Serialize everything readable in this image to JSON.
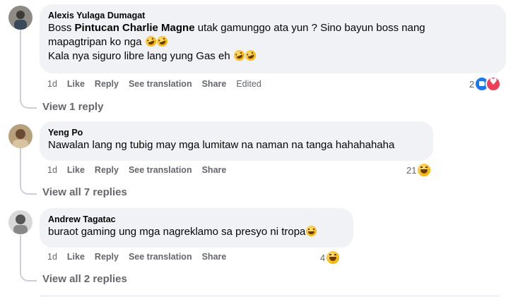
{
  "comments": [
    {
      "author": "Alexis Yulaga Dumagat",
      "line1_pre": "Boss ",
      "mention": "Pintucan Charlie Magne",
      "line1_post": " utak gamunggo ata yun ? Sino bayun boss nang",
      "line2": "mapagtripan ko nga",
      "line3": "Kala nya siguro libre lang yung Gas eh",
      "actions": {
        "time": "1d",
        "like": "Like",
        "reply": "Reply",
        "translate": "See translation",
        "share": "Share",
        "edited": "Edited"
      },
      "reaction_count": "2",
      "view_replies": "View 1 reply"
    },
    {
      "author": "Yeng Po",
      "line1": "Nawalan lang ng tubig may mga lumitaw na naman na tanga hahahahaha",
      "actions": {
        "time": "1d",
        "like": "Like",
        "reply": "Reply",
        "translate": "See translation",
        "share": "Share"
      },
      "reaction_count": "21",
      "view_replies": "View all 7 replies"
    },
    {
      "author": "Andrew Tagatac",
      "line1": "buraot gaming ung mga nagreklamo sa presyo ni tropa",
      "actions": {
        "time": "1d",
        "like": "Like",
        "reply": "Reply",
        "translate": "See translation",
        "share": "Share"
      },
      "reaction_count": "4",
      "view_replies": "View all 2 replies"
    }
  ],
  "colors": {
    "bubble": "#f0f2f5",
    "meta": "#65676b",
    "like": "#1877f2",
    "love": "#f33e58"
  }
}
